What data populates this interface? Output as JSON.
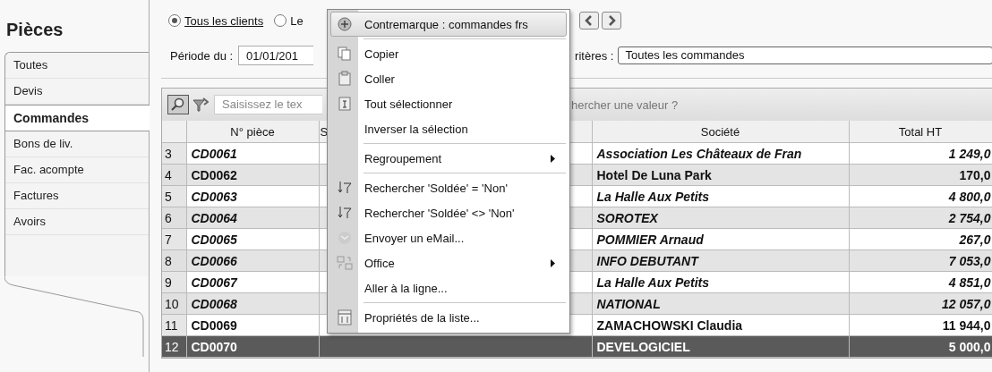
{
  "sidebar": {
    "title": "Pièces",
    "items": [
      {
        "label": "Toutes",
        "selected": false
      },
      {
        "label": "Devis",
        "selected": false
      },
      {
        "label": "Commandes",
        "selected": true
      },
      {
        "label": "Bons de liv.",
        "selected": false
      },
      {
        "label": "Fac. acompte",
        "selected": false
      },
      {
        "label": "Factures",
        "selected": false
      },
      {
        "label": "Avoirs",
        "selected": false
      }
    ]
  },
  "filters": {
    "radios": [
      {
        "label": "Tous les clients",
        "selected": true
      },
      {
        "label": "Le",
        "selected": false
      }
    ],
    "period_label": "Période du :",
    "period_from": "01/01/201",
    "criteria_label": "ritères :",
    "criteria_value": "Toutes les commandes"
  },
  "search": {
    "placeholder_start": "Saisissez le tex",
    "placeholder_end": "hercher une valeur ?"
  },
  "table": {
    "columns": [
      "N° pièce",
      "S",
      "Société",
      "Total HT"
    ],
    "rows": [
      {
        "index": "3",
        "number": "CD0061",
        "company": "Association Les Châteaux de Fran",
        "total": "1 249,0",
        "italic": true,
        "selected": false
      },
      {
        "index": "4",
        "number": "CD0062",
        "company": "Hotel De Luna Park",
        "total": "170,0",
        "italic": false,
        "selected": false
      },
      {
        "index": "5",
        "number": "CD0063",
        "company": "La Halle Aux Petits",
        "total": "4 800,0",
        "italic": true,
        "selected": false
      },
      {
        "index": "6",
        "number": "CD0064",
        "company": "SOROTEX",
        "total": "2 754,0",
        "italic": true,
        "selected": false
      },
      {
        "index": "7",
        "number": "CD0065",
        "company": "POMMIER Arnaud",
        "total": "267,0",
        "italic": true,
        "selected": false
      },
      {
        "index": "8",
        "number": "CD0066",
        "company": "INFO DEBUTANT",
        "total": "7 053,0",
        "italic": true,
        "selected": false
      },
      {
        "index": "9",
        "number": "CD0067",
        "company": "La Halle Aux Petits",
        "total": "4 851,0",
        "italic": true,
        "selected": false
      },
      {
        "index": "10",
        "number": "CD0068",
        "company": "NATIONAL",
        "total": "12 057,0",
        "italic": true,
        "selected": false
      },
      {
        "index": "11",
        "number": "CD0069",
        "company": "ZAMACHOWSKI Claudia",
        "total": "11 944,0",
        "italic": false,
        "selected": false
      },
      {
        "index": "12",
        "number": "CD0070",
        "company": "DEVELOGICIEL",
        "total": "5 000,0",
        "italic": false,
        "selected": true
      }
    ]
  },
  "context_menu": {
    "items": [
      {
        "kind": "item",
        "label": "Contremarque : commandes frs",
        "selected": true,
        "submenu": false
      },
      {
        "kind": "separator"
      },
      {
        "kind": "item",
        "label": "Copier",
        "selected": false,
        "submenu": false
      },
      {
        "kind": "item",
        "label": "Coller",
        "selected": false,
        "submenu": false
      },
      {
        "kind": "item",
        "label": "Tout sélectionner",
        "selected": false,
        "submenu": false
      },
      {
        "kind": "item",
        "label": "Inverser la sélection",
        "selected": false,
        "submenu": false
      },
      {
        "kind": "separator"
      },
      {
        "kind": "item",
        "label": "Regroupement",
        "selected": false,
        "submenu": true
      },
      {
        "kind": "separator"
      },
      {
        "kind": "item",
        "label": "Rechercher 'Soldée' = 'Non'",
        "selected": false,
        "submenu": false
      },
      {
        "kind": "item",
        "label": "Rechercher 'Soldée' <> 'Non'",
        "selected": false,
        "submenu": false
      },
      {
        "kind": "item",
        "label": "Envoyer un eMail...",
        "selected": false,
        "submenu": false
      },
      {
        "kind": "item",
        "label": "Office",
        "selected": false,
        "submenu": true
      },
      {
        "kind": "item",
        "label": "Aller à la ligne...",
        "selected": false,
        "submenu": false
      },
      {
        "kind": "separator"
      },
      {
        "kind": "item",
        "label": "Propriétés de la liste...",
        "selected": false,
        "submenu": false
      }
    ]
  }
}
